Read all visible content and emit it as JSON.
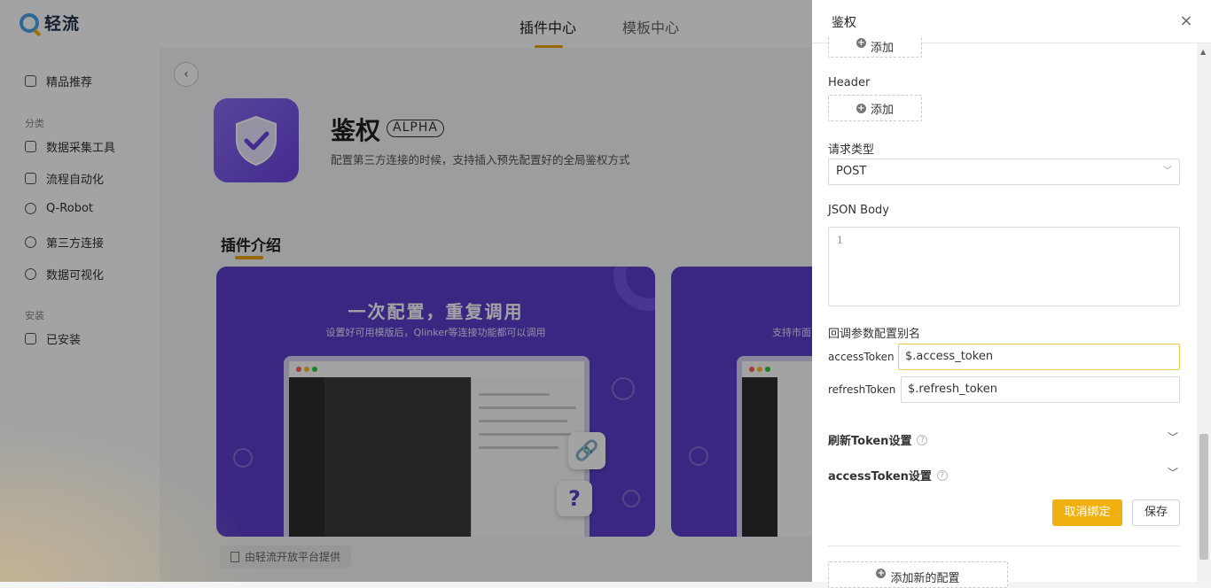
{
  "topbar": {
    "logo_text": "轻流",
    "tabs": [
      {
        "label": "插件中心",
        "active": true
      },
      {
        "label": "模板中心",
        "active": false
      }
    ]
  },
  "sidebar": {
    "recommended": "精品推荐",
    "group_category": "分类",
    "items": [
      "数据采集工具",
      "流程自动化",
      "Q-Robot",
      "第三方连接",
      "数据可视化"
    ],
    "group_install": "安装",
    "installed": "已安装"
  },
  "plugin": {
    "title": "鉴权",
    "badge": "ALPHA",
    "description": "配置第三方连接的时候，支持插入预先配置好的全局鉴权方式",
    "section_title": "插件介绍",
    "card1": {
      "headline": "一次配置，重复调用",
      "sub": "设置好可用模版后，Qlinker等连接功能都可以调用"
    },
    "card2": {
      "sub": "支持市面..."
    },
    "provided_by": "由轻流开放平台提供"
  },
  "drawer": {
    "title": "鉴权",
    "close_icon": "×",
    "top_add_label": "添加",
    "header_label": "Header",
    "header_add_label": "添加",
    "request_type_label": "请求类型",
    "request_type_value": "POST",
    "json_body_label": "JSON Body",
    "json_body_line": "1",
    "callback_alias_label": "回调参数配置别名",
    "access_token_label": "accessToken",
    "access_token_value": "$.access_token",
    "refresh_token_label": "refreshToken",
    "refresh_token_value": "$.refresh_token",
    "refresh_settings_label": "刷新Token设置",
    "access_settings_label": "accessToken设置",
    "cancel_bind_label": "取消绑定",
    "save_label": "保存",
    "add_config_label": "添加新的配置"
  },
  "colors": {
    "accent": "#f0b010",
    "purple": "#5b3ecb"
  }
}
